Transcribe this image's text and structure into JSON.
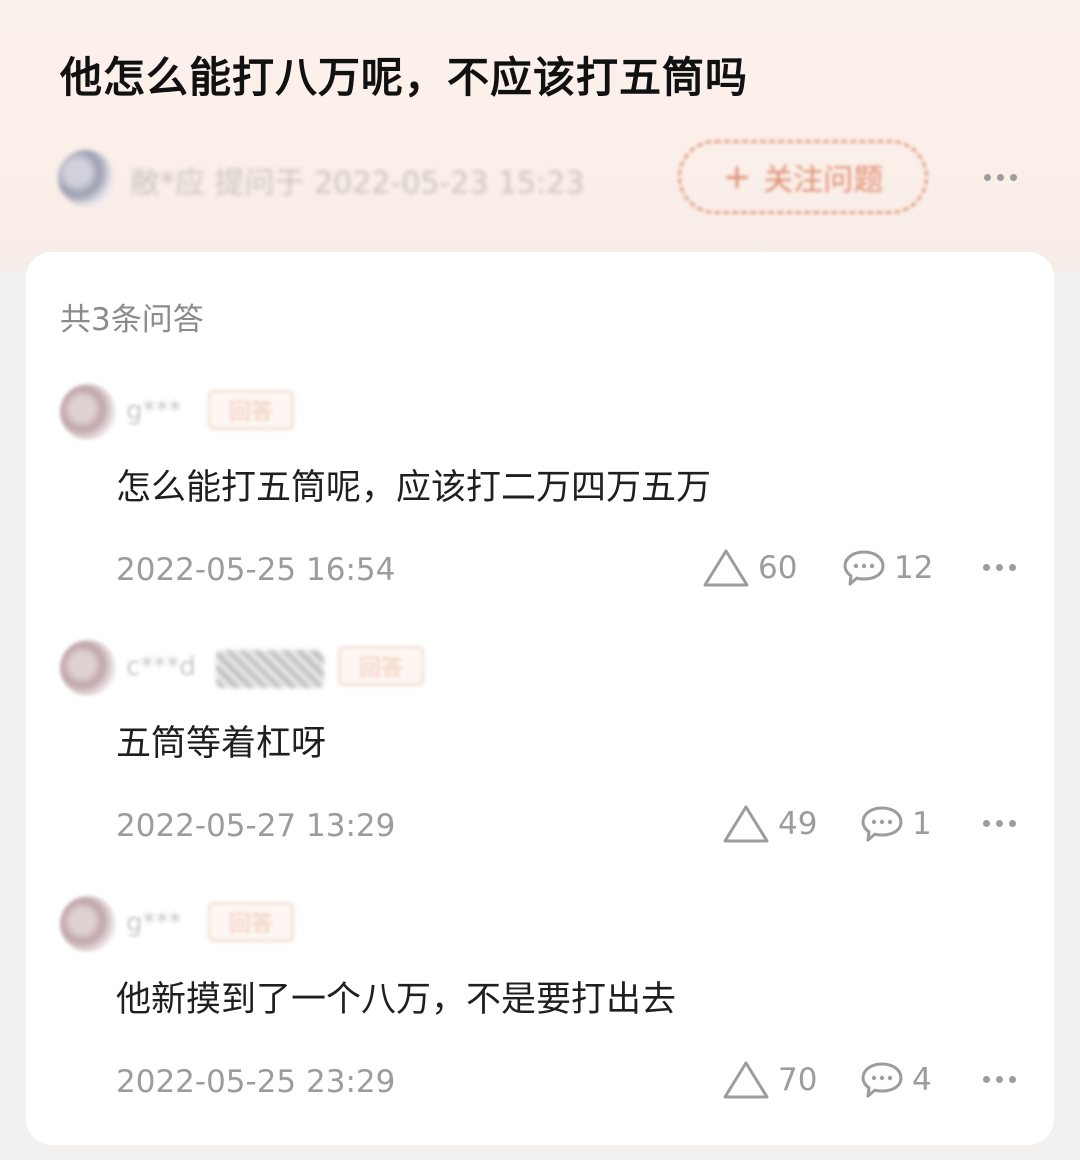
{
  "question": {
    "title": "他怎么能打八万呢，不应该打五筒吗",
    "asker_meta": "敝*应 提问于 2022-05-23 15:23",
    "follow_label": "关注问题"
  },
  "answers_header": {
    "count_label": "共3条问答"
  },
  "answers": [
    {
      "user": "g***",
      "badge": "回答",
      "text": "怎么能打五筒呢，应该打二万四万五万",
      "time": "2022-05-25 16:54",
      "likes": "60",
      "comments": "12"
    },
    {
      "user": "c***d",
      "badge": "回答",
      "text": "五筒等着杠呀",
      "time": "2022-05-27 13:29",
      "likes": "49",
      "comments": "1"
    },
    {
      "user": "g***",
      "badge": "回答",
      "text": "他新摸到了一个八万，不是要打出去",
      "time": "2022-05-25 23:29",
      "likes": "70",
      "comments": "4"
    }
  ],
  "icons": {
    "like": "triangle-up-icon",
    "comment": "speech-bubble-icon",
    "more": "more-dots-icon"
  },
  "colors": {
    "accent": "#e08e73",
    "meta_text": "#9c9c9c",
    "header_bg": "#fbf1ec"
  }
}
